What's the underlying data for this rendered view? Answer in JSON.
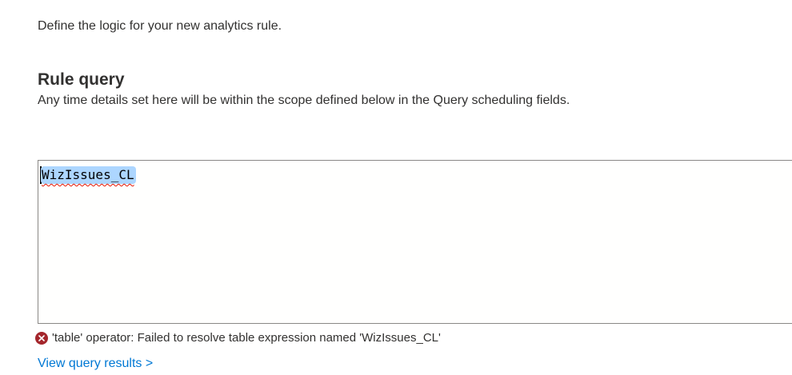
{
  "intro": {
    "text": "Define the logic for your new analytics rule."
  },
  "rule_query": {
    "title": "Rule query",
    "description": "Any time details set here will be within the scope defined below in the Query scheduling fields.",
    "query_value": "WizIssues_CL",
    "error_message": "'table' operator: Failed to resolve table expression named 'WizIssues_CL'",
    "results_link": "View query results >"
  },
  "colors": {
    "link": "#0078d4",
    "error_icon": "#a4262c",
    "selection": "#add6ff",
    "squiggle": "#e51400",
    "border": "#8a8886"
  }
}
